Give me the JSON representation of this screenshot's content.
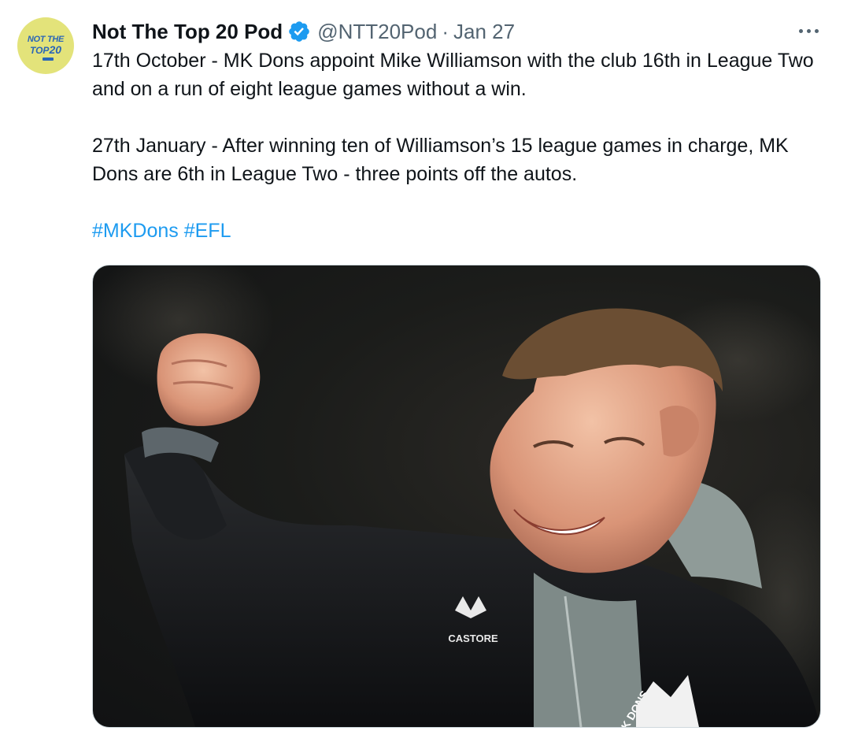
{
  "author": {
    "avatar_logo_line1": "NOT THE",
    "avatar_logo_line2": "TOP",
    "avatar_logo_number": "20",
    "name": "Not The Top 20 Pod",
    "verified_icon": "verified-badge-icon",
    "handle": "@NTT20Pod",
    "separator": "·",
    "date": "Jan 27"
  },
  "tweet": {
    "paragraph1": "17th October - MK Dons appoint Mike Williamson with the club 16th in League Two and on a run of eight league games without a win.",
    "paragraph2": "27th January - After winning ten of Williamson’s 15 league games in charge, MK Dons are 6th in League Two - three points off the autos.",
    "hashtags": [
      "#MKDons",
      "#EFL"
    ]
  },
  "media": {
    "jacket_brand": "CASTORE",
    "crest_text": "MK DONS"
  },
  "colors": {
    "link": "#1d9bf0",
    "secondary_text": "#536471",
    "verified": "#1d9bf0",
    "avatar_bg": "#e3e37a"
  }
}
